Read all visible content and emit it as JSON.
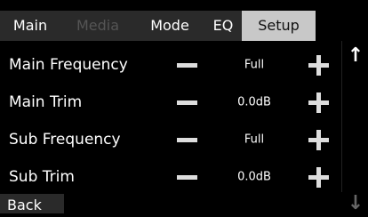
{
  "tabs": [
    {
      "label": "Main",
      "state": "normal"
    },
    {
      "label": "Media",
      "state": "disabled"
    },
    {
      "label": "Mode",
      "state": "normal"
    },
    {
      "label": "EQ",
      "state": "normal"
    },
    {
      "label": "Setup",
      "state": "active"
    }
  ],
  "settings": [
    {
      "label": "Main Frequency",
      "value": "Full"
    },
    {
      "label": "Main Trim",
      "value": "0.0dB"
    },
    {
      "label": "Sub Frequency",
      "value": "Full"
    },
    {
      "label": "Sub Trim",
      "value": "0.0dB"
    }
  ],
  "scroll": {
    "up_icon": "arrow-up",
    "down_icon": "arrow-down"
  },
  "footer": {
    "back_label": "Back"
  },
  "colors": {
    "background": "#000000",
    "tab_bar": "#2a2a2a",
    "tab_active": "#c8c8c8",
    "tab_disabled_text": "#555555"
  }
}
